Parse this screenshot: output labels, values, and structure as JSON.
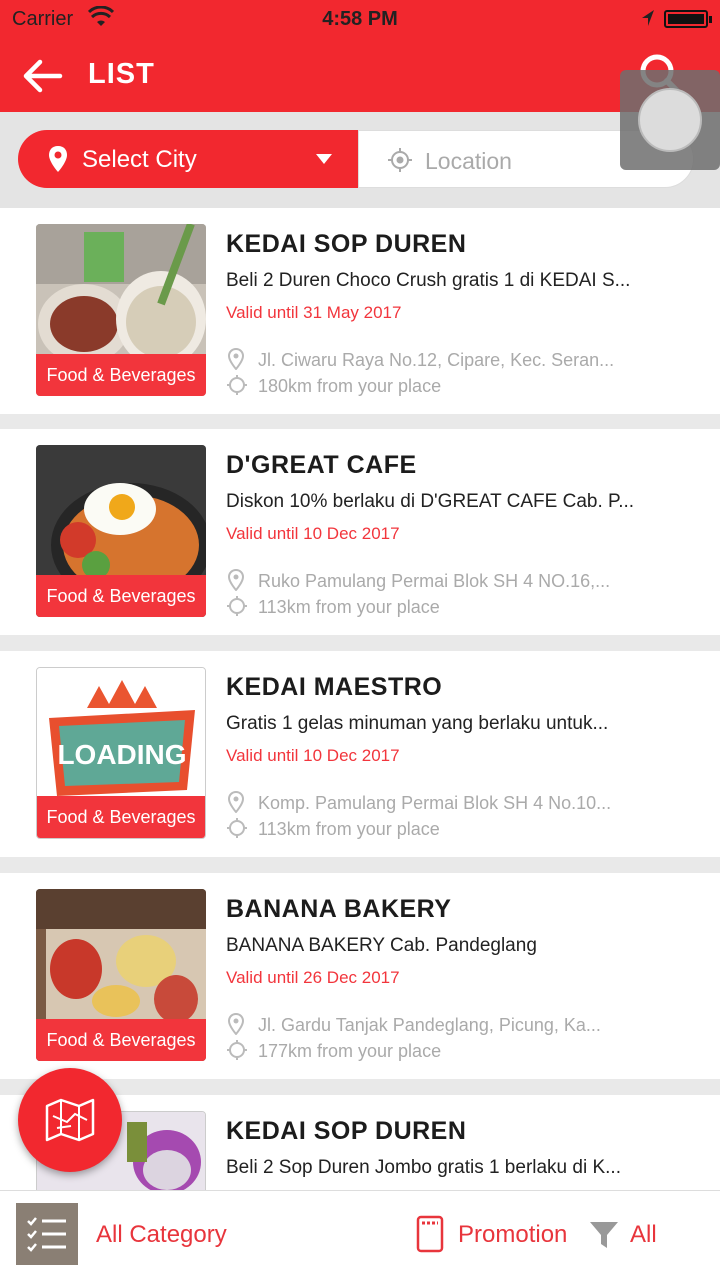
{
  "status_bar": {
    "carrier": "Carrier",
    "time": "4:58 PM"
  },
  "header": {
    "title": "LIST"
  },
  "filters": {
    "city_label": "Select City",
    "location_label": "Location"
  },
  "items": [
    {
      "name": "KEDAI SOP DUREN",
      "description": "Beli 2 Duren Choco Crush gratis 1 di KEDAI S...",
      "valid": "Valid until 31 May 2017",
      "address": "Jl. Ciwaru Raya No.12, Cipare, Kec. Seran...",
      "distance": "180km from your place",
      "category": "Food & Beverages"
    },
    {
      "name": "D'GREAT CAFE",
      "description": "Diskon 10% berlaku di D'GREAT CAFE Cab. P...",
      "valid": "Valid until 10 Dec 2017",
      "address": "Ruko Pamulang Permai Blok SH 4 NO.16,...",
      "distance": "113km from your place",
      "category": "Food & Beverages"
    },
    {
      "name": "KEDAI MAESTRO",
      "description": "Gratis 1 gelas minuman yang berlaku untuk...",
      "valid": "Valid until 10 Dec 2017",
      "address": "Komp. Pamulang Permai Blok SH 4 No.10...",
      "distance": "113km from your place",
      "category": "Food & Beverages",
      "image_text": "LOADING"
    },
    {
      "name": "BANANA BAKERY",
      "description": "BANANA BAKERY Cab. Pandeglang",
      "valid": "Valid until 26 Dec 2017",
      "address": "Jl. Gardu Tanjak Pandeglang,  Picung, Ka...",
      "distance": "177km from your place",
      "category": "Food & Beverages"
    },
    {
      "name": "KEDAI SOP DUREN",
      "description": "Beli 2 Sop Duren Jombo gratis 1 berlaku di K...",
      "valid": "",
      "address": "",
      "distance": "",
      "category": ""
    }
  ],
  "bottom_bar": {
    "category_label": "All Category",
    "promotion_label": "Promotion",
    "all_label": "All"
  },
  "colors": {
    "primary": "#f2282f",
    "accent_text": "#e8353c",
    "muted": "#aaaaaa"
  }
}
